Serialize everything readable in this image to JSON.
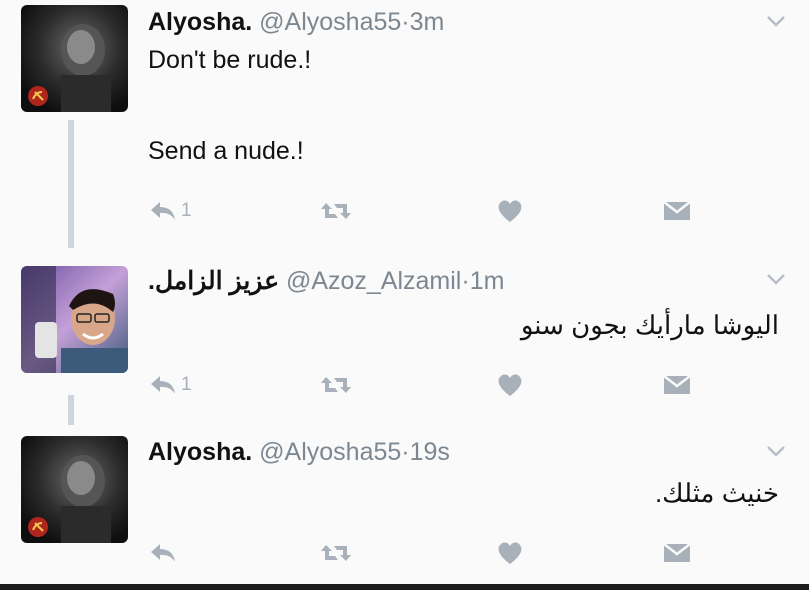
{
  "tweets": [
    {
      "name": "Alyosha.",
      "handle": "@Alyosha55",
      "separator": "·",
      "time": "3m",
      "lines": [
        "Don't be rude.!",
        "Send a nude.!"
      ],
      "reply_count": "1",
      "avatar_icon": "hammer-sickle-icon"
    },
    {
      "name": "عزيز الزامل.",
      "handle": "@Azoz_Alzamil",
      "separator": "·",
      "time": "1m",
      "lines": [
        "اليوشا مارأيك بجون سنو"
      ],
      "reply_count": "1",
      "avatar_icon": "person-photo"
    },
    {
      "name": "Alyosha.",
      "handle": "@Alyosha55",
      "separator": "·",
      "time": "19s",
      "lines": [
        "خنيث مثلك."
      ],
      "reply_count": "",
      "avatar_icon": "hammer-sickle-icon"
    }
  ],
  "colors": {
    "text": "#111111",
    "muted": "#7c8792",
    "icon": "#a8b1ba",
    "thread_line": "#cfd5dc"
  }
}
